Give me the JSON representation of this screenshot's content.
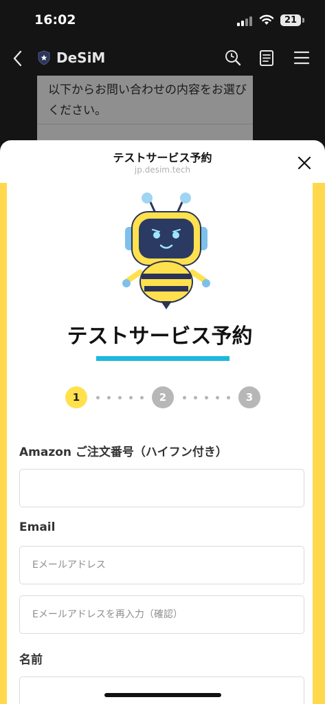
{
  "status_bar": {
    "time": "16:02",
    "battery": "21"
  },
  "nav": {
    "site_name": "DeSiM"
  },
  "background_page": {
    "text": "以下からお問い合わせの内容をお選びください。"
  },
  "sheet": {
    "title": "テストサービス予約",
    "domain": "jp.desim.tech"
  },
  "form": {
    "title": "テストサービス予約",
    "steps": [
      "1",
      "2",
      "3"
    ],
    "current_step": "1",
    "order_label": "Amazon ご注文番号（ハイフン付き）",
    "order_value": "",
    "email_label": "Email",
    "email_placeholder": "Eメールアドレス",
    "email_confirm_placeholder": "Eメールアドレスを再入力（確認）",
    "name_label": "名前",
    "name_value": ""
  },
  "colors": {
    "accent_yellow": "#ffd84e",
    "underline_blue": "#1eb8dd",
    "step_inactive": "#b7b7b7"
  },
  "icons": [
    "back-chevron-icon",
    "shield-star-icon",
    "search-icon",
    "document-icon",
    "menu-icon",
    "close-icon",
    "bee-robot-mascot"
  ]
}
